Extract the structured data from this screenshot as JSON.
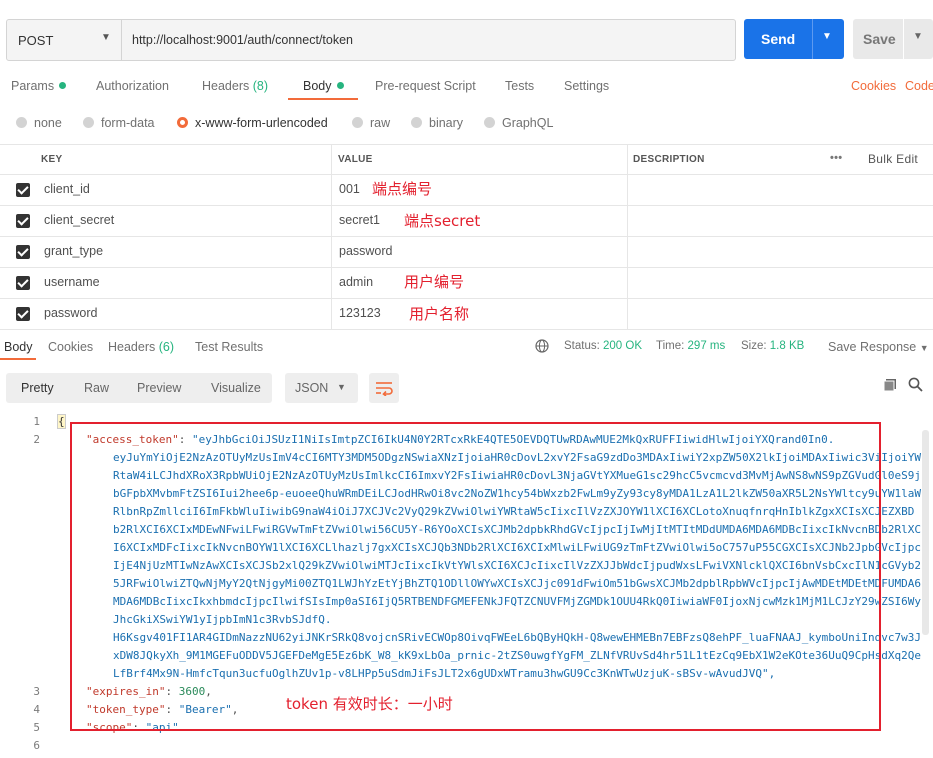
{
  "request": {
    "method": "POST",
    "url": "http://localhost:9001/auth/connect/token",
    "send_label": "Send",
    "save_label": "Save"
  },
  "request_tabs": {
    "params": "Params",
    "authorization": "Authorization",
    "headers": "Headers",
    "headers_count": "(8)",
    "body": "Body",
    "prerequest": "Pre-request Script",
    "tests": "Tests",
    "settings": "Settings",
    "cookies": "Cookies",
    "code": "Code"
  },
  "body_types": {
    "none": "none",
    "form_data": "form-data",
    "urlencoded": "x-www-form-urlencoded",
    "raw": "raw",
    "binary": "binary",
    "graphql": "GraphQL"
  },
  "table": {
    "headers": {
      "key": "KEY",
      "value": "VALUE",
      "description": "DESCRIPTION",
      "bulk_edit": "Bulk Edit",
      "more": "•••"
    },
    "rows": [
      {
        "key": "client_id",
        "value": "001",
        "note": "端点编号"
      },
      {
        "key": "client_secret",
        "value": "secret1",
        "note": "端点secret"
      },
      {
        "key": "grant_type",
        "value": "password",
        "note": ""
      },
      {
        "key": "username",
        "value": "admin",
        "note": "用户编号"
      },
      {
        "key": "password",
        "value": "123123",
        "note": "用户名称"
      }
    ]
  },
  "response_tabs": {
    "body": "Body",
    "cookies": "Cookies",
    "headers": "Headers",
    "headers_count": "(6)",
    "test_results": "Test Results",
    "status_label": "Status:",
    "status_value": "200 OK",
    "time_label": "Time:",
    "time_value": "297 ms",
    "size_label": "Size:",
    "size_value": "1.8 KB",
    "save_response": "Save Response"
  },
  "view_modes": {
    "pretty": "Pretty",
    "raw": "Raw",
    "preview": "Preview",
    "visualize": "Visualize",
    "format": "JSON"
  },
  "code": {
    "line1": "{",
    "access_token_key": "\"access_token\"",
    "access_token_first": "\"eyJhbGciOiJSUzI1NiIsImtpZCI6IkU4N0Y2RTcxRkE4QTE5OEVDQTUwRDAwMUE2MkQxRUFFIiwidHlwIjoiYXQrand0In0.",
    "access_token_lines": [
      "eyJuYmYiOjE2NzAzOTUyMzUsImV4cCI6MTY3MDM5ODgzNSwiaXNzIjoiaHR0cDovL2xvY2FsaG9zdDo3MDAxIiwiY2xpZW50X2lkIjoiMDAxIiwic3ViIjoiYW",
      "RtaW4iLCJhdXRoX3RpbWUiOjE2NzAzOTUyMzUsImlkcCI6ImxvY2FsIiwiaHR0cDovL3NjaGVtYXMueG1sc29hcC5vcmcvd3MvMjAwNS8wNS9pZGVudGl0eS9j",
      "bGFpbXMvbmFtZSI6Iui2hee6p-euoeeQhuWRmDEiLCJodHRwOi8vc2NoZW1hcy54bWxzb2FwLm9yZy93cy8yMDA1LzA1L2lkZW50aXR5L2NsYWltcy9uYW1laW",
      "RlbnRpZmllciI6ImFkbWluIiwibG9naW4iOiJ7XCJVc2VyQ29kZVwiOlwiYWRtaW5cIixcIlVzZXJOYW1lXCI6XCLotoXnuqfnrqHnIblkZgxXCIsXCJEZXBD",
      "b2RlXCI6XCIxMDEwNFwiLFwiRGVwTmFtZVwiOlwi56CU5Y-R6YOoXCIsXCJMb2dpbkRhdGVcIjpcIjIwMjItMTItMDdUMDA6MDA6MDBcIixcIkNvcnBDb2RlXC",
      "I6XCIxMDFcIixcIkNvcnBOYW1lXCI6XCLlhazlj7gxXCIsXCJQb3NDb2RlXCI6XCIxMlwiLFwiUG9zTmFtZVwiOlwi5oC757uP55CGXCIsXCJNb2JpbGVcIjpc",
      "IjE4NjUzMTIwNzAwXCIsXCJSb2xlQ29kZVwiOlwiMTJcIixcIkVtYWlsXCI6XCJcIixcIlVzZXJJbWdcIjpudWxsLFwiVXNlcklQXCI6bnVsbCxcIlN1cGVyb2",
      "5JRFwiOlwiZTQwNjMyY2QtNjgyMi00ZTQ1LWJhYzEtYjBhZTQ1ODllOWYwXCIsXCJjc091dFwiOm51bGwsXCJMb2dpblRpbWVcIjpcIjAwMDEtMDEtMDFUMDA6",
      "MDA6MDBcIixcIkxhbmdcIjpcIlwifSIsImp0aSI6IjQ5RTBENDFGMEFENkJFQTZCNUVFMjZGMDk1OUU4RkQ0IiwiaWF0IjoxNjcwMzk1MjM1LCJzY29wZSI6Wy",
      "JhcGkiXSwiYW1yIjpbImN1c3RvbSJdfQ.",
      "H6Ksgv401FI1AR4GIDmNazzNU62yiJNKrSRkQ8vojcnSRivECWOp8OivqFWEeL6bQByHQkH-Q8wewEHMEBn7EBFzsQ8ehPF_luaFNAAJ_kymboUniIndvc7w3J",
      "xDW8JQkyXh_9M1MGEFuODDV5JGEFDeMgE5Ez6bK_W8_kK9xLbOa_prnic-2tZS0uwgfYgFM_ZLNfVRUvSd4hr51L1tEzCq9EbX1W2eKOte36UuQ9CpHsdXq2Qe",
      "LfBrf4Mx9N-HmfcTqun3ucfuOglhZUv1p-v8LHPp5uSdmJiFsJLT2x6gUDxWTramu3hwGU9Cc3KnWTwUzjuK-sBSv-wAvudJVQ\","
    ],
    "expires_in_key": "\"expires_in\"",
    "expires_in_value": "3600",
    "token_type_key": "\"token_type\"",
    "token_type_value": "\"Bearer\"",
    "scope_key": "\"scope\"",
    "scope_value": "\"api\"",
    "annotation": "token 有效时长：一小时",
    "line_numbers": [
      "1",
      "2",
      "3",
      "4",
      "5",
      "6"
    ]
  },
  "colors": {
    "accent": "#f26b3a",
    "send": "#1a73e8",
    "annotation": "#e3202e",
    "ok": "#26b47f"
  }
}
